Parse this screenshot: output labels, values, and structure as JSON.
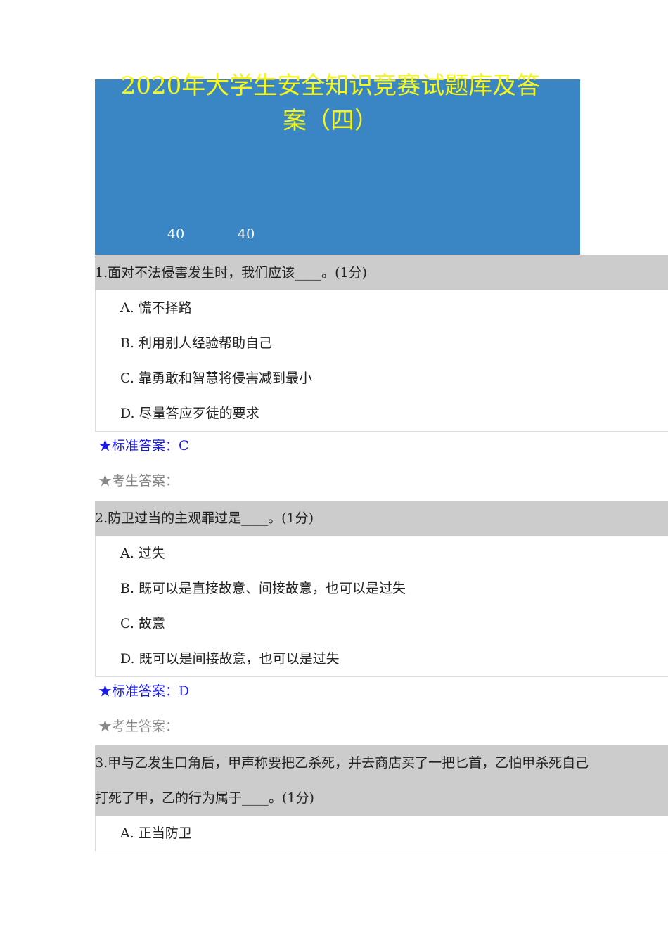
{
  "title_line1": "2020年大学生安全知识竞赛试题库及答",
  "title_line2": "案（四）",
  "banner_numbers": [
    "40",
    "40"
  ],
  "questions": [
    {
      "text": "1.面对不法侵害发生时，我们应该____。(1分)",
      "options": [
        "A.  慌不择路",
        "B.  利用别人经验帮助自己",
        "C.  靠勇敢和智慧将侵害减到最小",
        "D.  尽量答应歹徒的要求"
      ],
      "standard_answer": "★标准答案：C",
      "student_answer": "★考生答案："
    },
    {
      "text": "2.防卫过当的主观罪过是____。(1分)",
      "options": [
        "A.  过失",
        "B.  既可以是直接故意、间接故意，也可以是过失",
        "C.  故意",
        "D.  既可以是间接故意，也可以是过失"
      ],
      "standard_answer": "★标准答案：D",
      "student_answer": "★考生答案："
    },
    {
      "text_line1": "3.甲与乙发生口角后，甲声称要把乙杀死，并去商店买了一把匕首，乙怕甲杀死自己",
      "text_line2": "打死了甲，乙的行为属于____。(1分)",
      "options": [
        "A.  正当防卫"
      ]
    }
  ]
}
